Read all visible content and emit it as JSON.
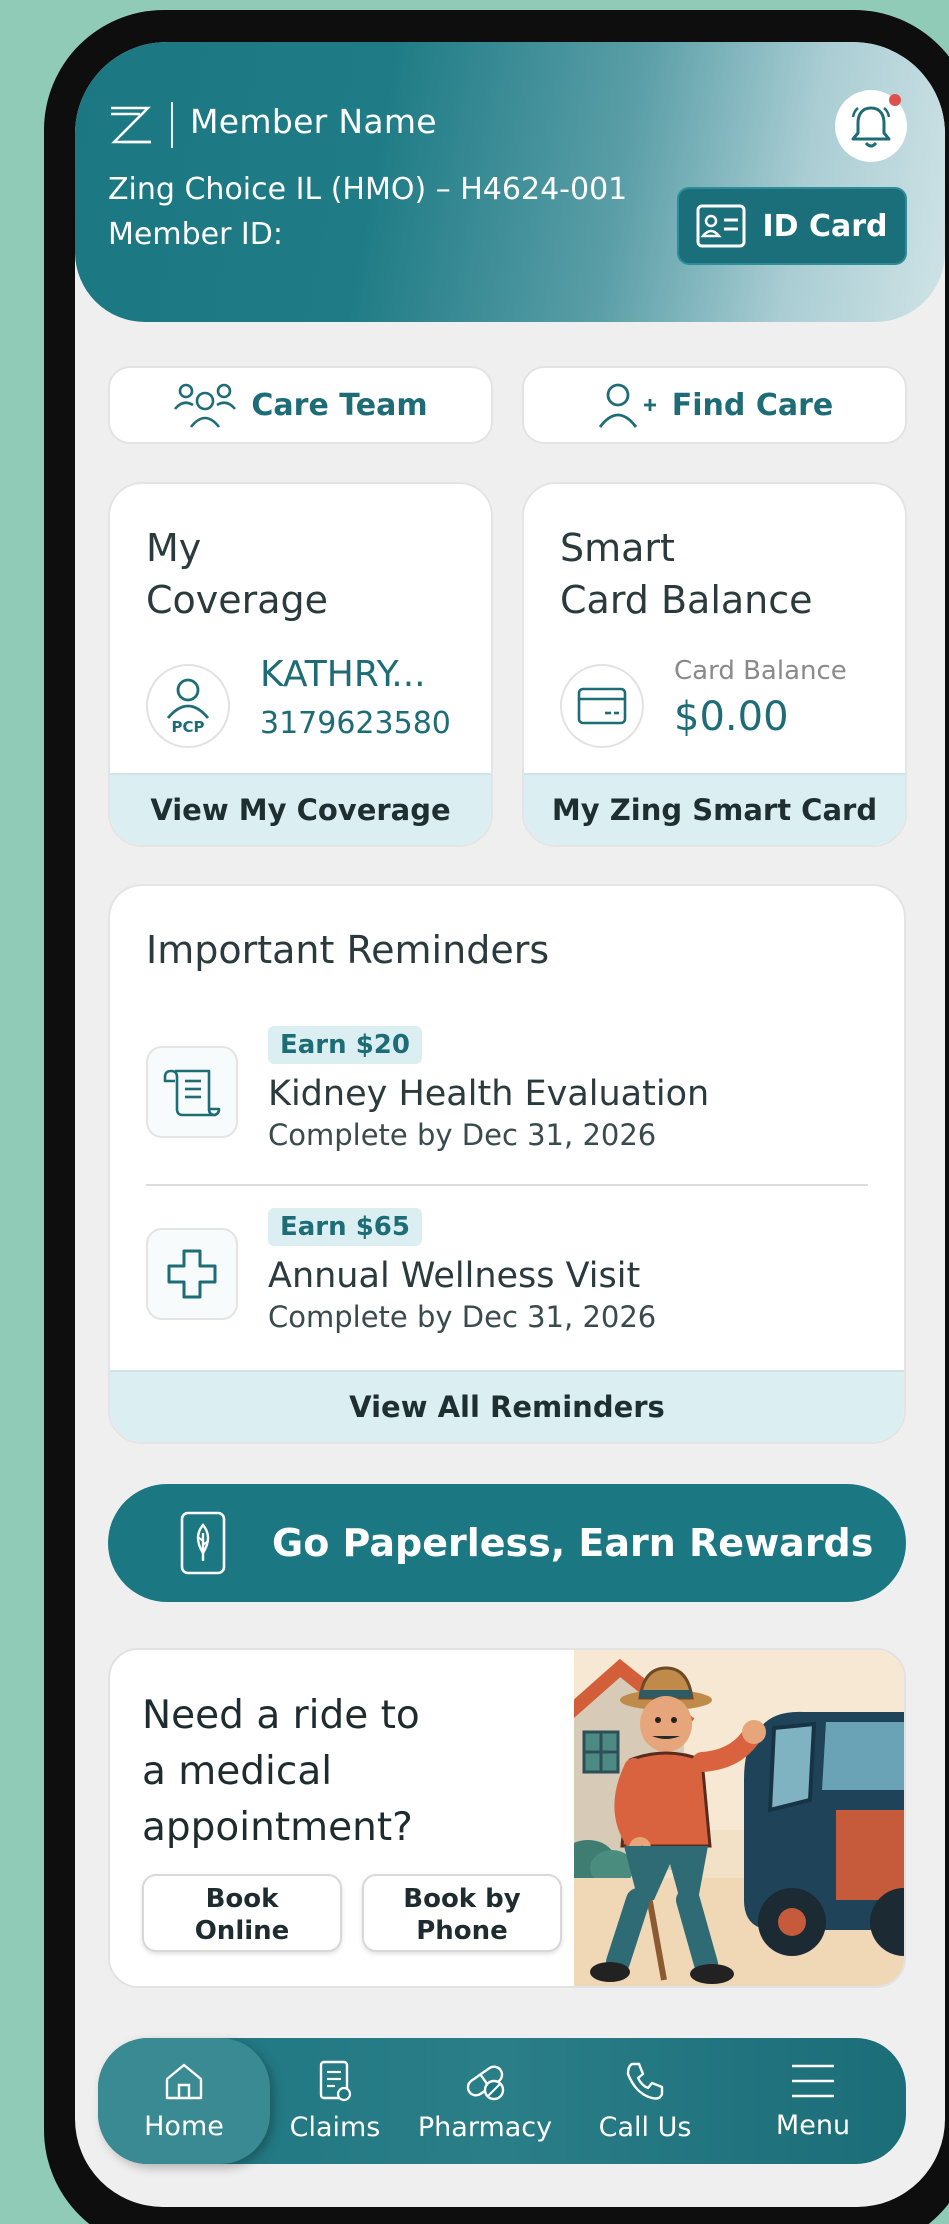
{
  "header": {
    "member_name": "Member Name",
    "plan": "Zing Choice IL (HMO) – H4624-001",
    "member_id_label": "Member ID:",
    "id_card_label": "ID Card"
  },
  "quick_actions": {
    "care_team": "Care Team",
    "find_care": "Find Care"
  },
  "coverage": {
    "title_line1": "My",
    "title_line2": "Coverage",
    "pcp_badge": "PCP",
    "pcp_name": "KATHRY...",
    "pcp_phone": "3179623580",
    "footer": "View My Coverage"
  },
  "smart_card": {
    "title_line1": "Smart",
    "title_line2": "Card Balance",
    "balance_label": "Card Balance",
    "balance_value": "$0.00",
    "footer": "My Zing Smart Card"
  },
  "reminders": {
    "title": "Important Reminders",
    "items": [
      {
        "earn": "Earn $20",
        "title": "Kidney Health Evaluation",
        "due": "Complete by Dec 31, 2026",
        "icon": "scroll-icon"
      },
      {
        "earn": "Earn $65",
        "title": "Annual Wellness Visit",
        "due": "Complete by Dec 31, 2026",
        "icon": "medical-cross-icon"
      }
    ],
    "footer": "View All Reminders"
  },
  "paperless": {
    "label": "Go Paperless, Earn Rewards"
  },
  "ride": {
    "text": "Need a ride to a medical appointment?",
    "book_online": "Book\nOnline",
    "book_phone": "Book by\nPhone"
  },
  "nav": {
    "home": "Home",
    "claims": "Claims",
    "pharmacy": "Pharmacy",
    "call_us": "Call Us",
    "menu": "Menu"
  },
  "colors": {
    "primary": "#1b7782",
    "accent_light": "#dbeff3",
    "background": "#8fcbb7",
    "notification_dot": "#e0504a"
  }
}
